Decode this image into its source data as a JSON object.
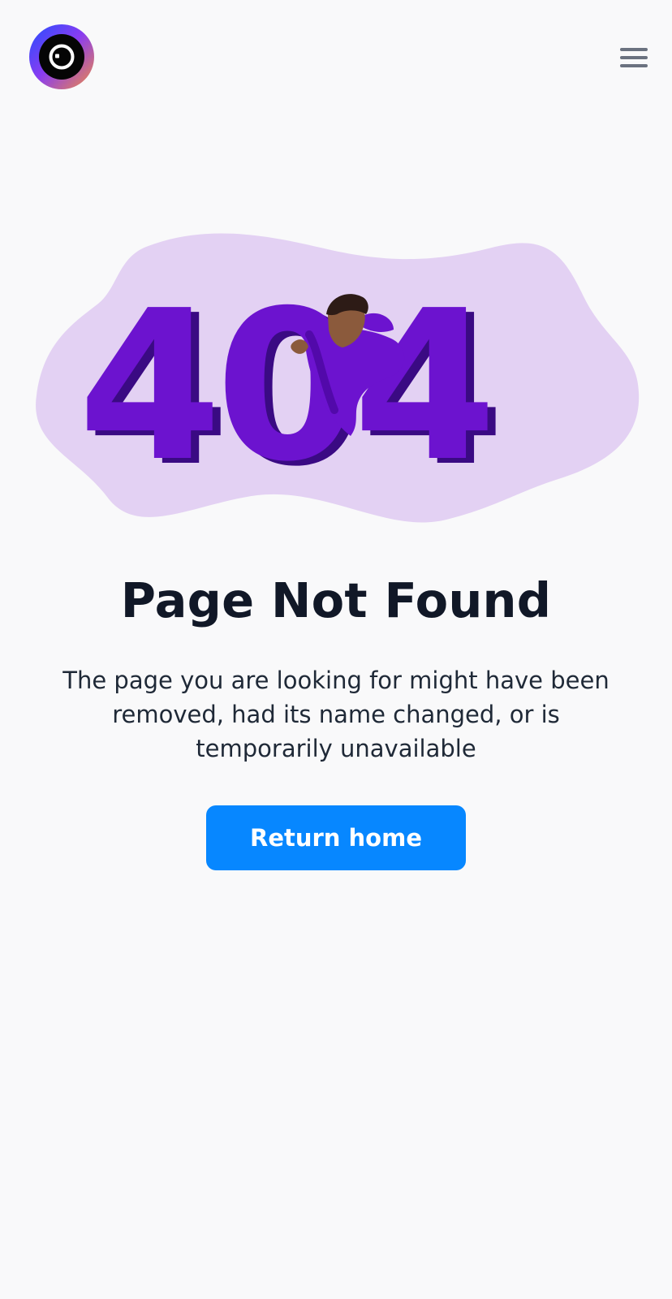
{
  "header": {
    "logo_icon": "camera-lens-icon",
    "menu_icon": "hamburger-menu-icon"
  },
  "illustration": {
    "code_text": "404",
    "background_color": "#e3d1f3",
    "digit_color": "#6c13cf",
    "digit_shadow_color": "#3a0a83",
    "person_skin_color": "#8b5a3c",
    "person_shirt_color": "#6c13cf"
  },
  "content": {
    "title": "Page Not Found",
    "description": "The page you are looking for might have been removed, had its name changed, or is temporarily unavailable",
    "button_label": "Return home",
    "button_color": "#0787ff"
  }
}
